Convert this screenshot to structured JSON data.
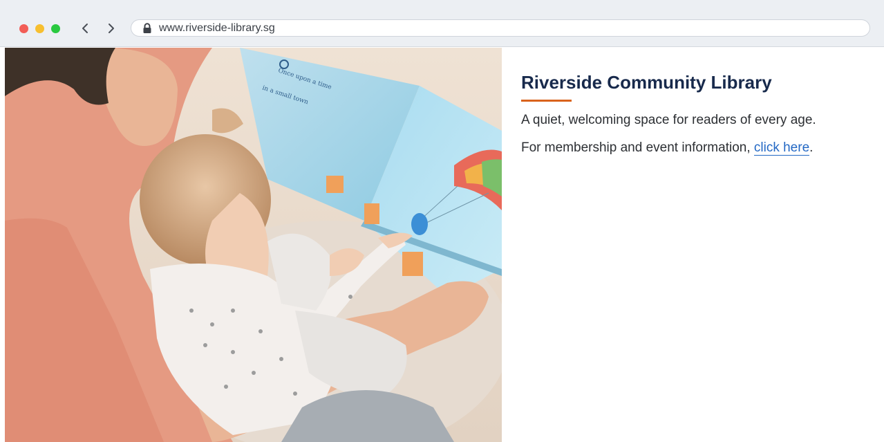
{
  "browser": {
    "url": "www.riverside-library.sg"
  },
  "hero": {
    "alt": "Adult and child reading a picture book together"
  },
  "content": {
    "title": "Riverside Community Library",
    "tagline": "A quiet, welcoming space for readers of every age.",
    "info_prefix": "For membership and event information, ",
    "link_text": "click here",
    "info_suffix": "."
  },
  "colors": {
    "title": "#182a4c",
    "accent": "#d9631c",
    "link": "#2368c4"
  }
}
